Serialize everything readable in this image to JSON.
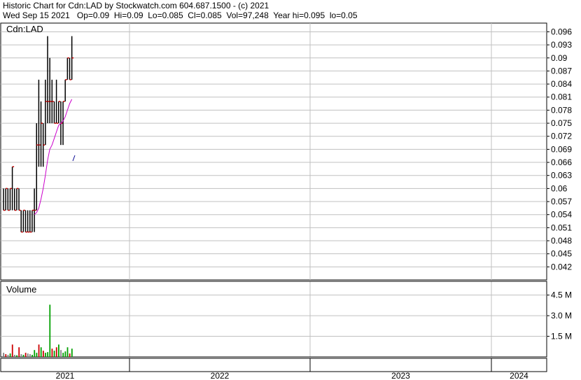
{
  "header": {
    "line1": "Historic Chart for Cdn:LAD by Stockwatch.com 604.687.1500 - (c) 2021",
    "line2": "Wed Sep 15 2021   Op=0.09  Hi=0.09  Lo=0.085  Cl=0.085  Vol=97,248  Year hi=0.095  lo=0.05"
  },
  "chart_data": [
    {
      "type": "ohlc",
      "title": "Cdn:LAD",
      "ylim": [
        0.039,
        0.098
      ],
      "y_ticks": [
        "0.096",
        "0.093",
        "0.09",
        "0.087",
        "0.084",
        "0.081",
        "0.078",
        "0.075",
        "0.072",
        "0.069",
        "0.066",
        "0.063",
        "0.06",
        "0.057",
        "0.054",
        "0.051",
        "0.048",
        "0.045",
        "0.042"
      ],
      "x_labels": [
        "2021",
        "2022",
        "2023",
        "2024"
      ],
      "grid": true,
      "colors": {
        "bar": "#000000",
        "close_tick": "#cc0000",
        "moving_average": "#cc00cc",
        "gridline": "#c0c0c0"
      },
      "bars": [
        {
          "h": 0.06,
          "l": 0.055,
          "c": 0.055
        },
        {
          "h": 0.06,
          "l": 0.055,
          "c": 0.06
        },
        {
          "h": 0.06,
          "l": 0.055,
          "c": 0.055
        },
        {
          "h": 0.06,
          "l": 0.055,
          "c": 0.06
        },
        {
          "h": 0.065,
          "l": 0.055,
          "c": 0.065
        },
        {
          "h": 0.06,
          "l": 0.055,
          "c": 0.055
        },
        {
          "h": 0.06,
          "l": 0.055,
          "c": 0.06
        },
        {
          "h": 0.06,
          "l": 0.055,
          "c": 0.055
        },
        {
          "h": 0.055,
          "l": 0.05,
          "c": 0.05
        },
        {
          "h": 0.055,
          "l": 0.05,
          "c": 0.055
        },
        {
          "h": 0.055,
          "l": 0.05,
          "c": 0.05
        },
        {
          "h": 0.055,
          "l": 0.05,
          "c": 0.05
        },
        {
          "h": 0.055,
          "l": 0.05,
          "c": 0.05
        },
        {
          "h": 0.055,
          "l": 0.05,
          "c": 0.055
        },
        {
          "h": 0.06,
          "l": 0.05,
          "c": 0.055
        },
        {
          "h": 0.075,
          "l": 0.055,
          "c": 0.07
        },
        {
          "h": 0.085,
          "l": 0.065,
          "c": 0.07
        },
        {
          "h": 0.08,
          "l": 0.065,
          "c": 0.075
        },
        {
          "h": 0.075,
          "l": 0.065,
          "c": 0.07
        },
        {
          "h": 0.085,
          "l": 0.07,
          "c": 0.08
        },
        {
          "h": 0.095,
          "l": 0.075,
          "c": 0.08
        },
        {
          "h": 0.09,
          "l": 0.075,
          "c": 0.08
        },
        {
          "h": 0.085,
          "l": 0.075,
          "c": 0.08
        },
        {
          "h": 0.08,
          "l": 0.075,
          "c": 0.075
        },
        {
          "h": 0.085,
          "l": 0.075,
          "c": 0.075
        },
        {
          "h": 0.08,
          "l": 0.075,
          "c": 0.08
        },
        {
          "h": 0.08,
          "l": 0.07,
          "c": 0.075
        },
        {
          "h": 0.08,
          "l": 0.07,
          "c": 0.08
        },
        {
          "h": 0.085,
          "l": 0.08,
          "c": 0.085
        },
        {
          "h": 0.09,
          "l": 0.085,
          "c": 0.09
        },
        {
          "h": 0.09,
          "l": 0.085,
          "c": 0.085
        },
        {
          "h": 0.095,
          "l": 0.085,
          "c": 0.09
        }
      ],
      "moving_average": [
        0.054,
        0.0545,
        0.0555,
        0.0575,
        0.06,
        0.063,
        0.0665,
        0.069,
        0.07,
        0.0715,
        0.073,
        0.0745,
        0.075,
        0.0755,
        0.0765,
        0.078,
        0.0795,
        0.0805
      ],
      "moving_average_start_bar": 14
    },
    {
      "type": "bar",
      "title": "Volume",
      "ylim": [
        0,
        5500000
      ],
      "y_ticks": [
        "4.5 M",
        "3.0 M",
        "1.5 M"
      ],
      "grid": true,
      "colors": {
        "up": "#00a000",
        "down": "#cc0000",
        "flat": "#808080"
      },
      "values": [
        300000,
        200000,
        150000,
        250000,
        900000,
        150000,
        120000,
        700000,
        200000,
        150000,
        300000,
        250000,
        200000,
        150000,
        500000,
        300000,
        900000,
        700000,
        450000,
        300000,
        350000,
        3800000,
        600000,
        450000,
        700000,
        900000,
        500000,
        300000,
        400000,
        700000,
        250000,
        600000
      ],
      "directions": [
        "flat",
        "down",
        "flat",
        "up",
        "down",
        "flat",
        "up",
        "down",
        "flat",
        "up",
        "down",
        "flat",
        "flat",
        "up",
        "up",
        "up",
        "down",
        "up",
        "down",
        "up",
        "up",
        "up",
        "down",
        "up",
        "down",
        "up",
        "flat",
        "up",
        "up",
        "up",
        "down",
        "up"
      ]
    }
  ]
}
